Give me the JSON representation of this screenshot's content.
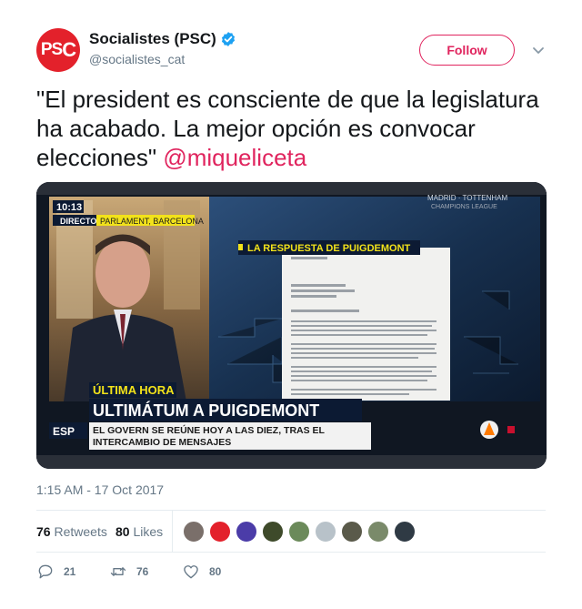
{
  "author": {
    "avatar_text": "PS",
    "avatar_text_c": "C",
    "display_name": "Socialistes (PSC)",
    "handle": "@socialistes_cat",
    "verified": true
  },
  "follow_label": "Follow",
  "tweet": {
    "text": "\"El president es consciente de que la legislatura ha acabado. La mejor opción es convocar elecciones\" ",
    "mention": "@miqueliceta",
    "timestamp": "1:15 AM - 17 Oct 2017"
  },
  "media": {
    "clock": "10:13",
    "live_tag": "DIRECTO",
    "location_tag": "PARLAMENT, BARCELONA",
    "corner_text_1": "MADRID · TOTTENHAM",
    "corner_text_2": "CHAMPIONS LEAGUE",
    "panel_title": "LA RESPUESTA DE PUIGDEMONT",
    "breaking": "ÚLTIMA HORA",
    "headline": "ULTIMÁTUM A PUIGDEMONT",
    "subline_1": "EL GOVERN SE REÚNE HOY A LAS DIEZ, TRAS EL",
    "subline_2": "INTERCAMBIO DE MENSAJES",
    "channel_tag": "ESP"
  },
  "stats": {
    "retweets_count": "76",
    "retweets_label": "Retweets",
    "likes_count": "80",
    "likes_label": "Likes"
  },
  "likers": [
    "#7a6f6a",
    "#e3212b",
    "#4b3ca8",
    "#3e4a2a",
    "#6b8a5a",
    "#b8c2c9",
    "#5a5a4a",
    "#7a8a6a",
    "#2f3a44"
  ],
  "actions": {
    "replies": "21",
    "retweets": "76",
    "likes": "80"
  },
  "colors": {
    "accent": "#e0245e",
    "verified": "#1da1f2",
    "muted": "#657786"
  }
}
